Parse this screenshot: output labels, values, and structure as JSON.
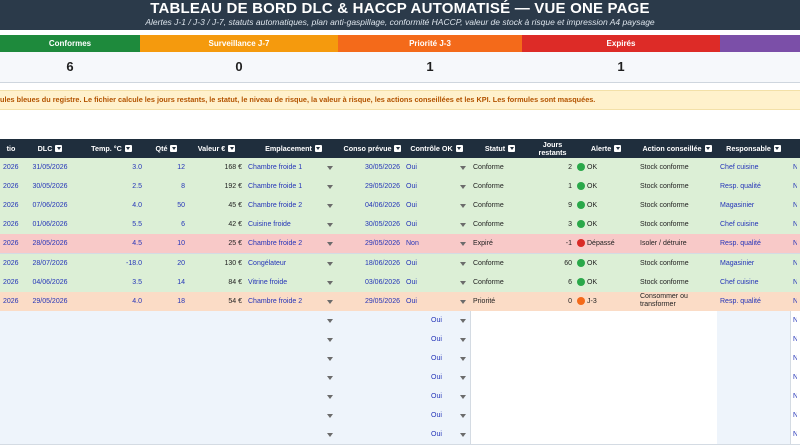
{
  "header": {
    "title": "TABLEAU DE BORD DLC & HACCP AUTOMATISÉ — VUE ONE PAGE",
    "subtitle": "Alertes J-1 / J-3 / J-7, statuts automatiques, plan anti-gaspillage, conformité HACCP, valeur de stock à risque et impression A4 paysage"
  },
  "kpis": [
    {
      "label": "Conformes",
      "value": "6",
      "color": "#1e8a3c"
    },
    {
      "label": "Surveillance J-7",
      "value": "0",
      "color": "#f59a0d"
    },
    {
      "label": "Priorité J-3",
      "value": "1",
      "color": "#f46a1a"
    },
    {
      "label": "Expirés",
      "value": "1",
      "color": "#dd2b27"
    },
    {
      "label": "",
      "value": "",
      "color": "#7b4fa8"
    }
  ],
  "note": "ules bleues du registre. Le fichier calcule les jours restants, le statut, le niveau de risque, la valeur à risque, les actions conseillées et les KPI. Les formules sont masquées.",
  "columns": [
    {
      "key": "rec",
      "label": "tio"
    },
    {
      "key": "dlc",
      "label": "DLC"
    },
    {
      "key": "temp",
      "label": "Temp. °C"
    },
    {
      "key": "qte",
      "label": "Qté"
    },
    {
      "key": "valeur",
      "label": "Valeur €"
    },
    {
      "key": "emplacement",
      "label": "Emplacement"
    },
    {
      "key": "conso",
      "label": "Conso prévue"
    },
    {
      "key": "controle",
      "label": "Contrôle OK"
    },
    {
      "key": "statut",
      "label": "Statut"
    },
    {
      "key": "jours",
      "label": "Jours restants"
    },
    {
      "key": "alerte",
      "label": "Alerte"
    },
    {
      "key": "action",
      "label": "Action conseillée"
    },
    {
      "key": "resp",
      "label": "Responsable"
    },
    {
      "key": "extra",
      "label": ""
    }
  ],
  "rows": [
    {
      "rec": "2026",
      "dlc": "31/05/2026",
      "temp": "3.0",
      "qte": "12",
      "valeur": "168 €",
      "emplacement": "Chambre froide 1",
      "conso": "30/05/2026",
      "controle": "Oui",
      "statut": "Conforme",
      "jours": "2",
      "alerte": "OK",
      "alert_color": "#2aa84a",
      "action": "Stock conforme",
      "resp": "Chef cuisine",
      "extra": "No",
      "bg": "#dcefd6"
    },
    {
      "rec": "2026",
      "dlc": "30/05/2026",
      "temp": "2.5",
      "qte": "8",
      "valeur": "192 €",
      "emplacement": "Chambre froide 1",
      "conso": "29/05/2026",
      "controle": "Oui",
      "statut": "Conforme",
      "jours": "1",
      "alerte": "OK",
      "alert_color": "#2aa84a",
      "action": "Stock conforme",
      "resp": "Resp. qualité",
      "extra": "No",
      "bg": "#dcefd6"
    },
    {
      "rec": "2026",
      "dlc": "07/06/2026",
      "temp": "4.0",
      "qte": "50",
      "valeur": "45 €",
      "emplacement": "Chambre froide 2",
      "conso": "04/06/2026",
      "controle": "Oui",
      "statut": "Conforme",
      "jours": "9",
      "alerte": "OK",
      "alert_color": "#2aa84a",
      "action": "Stock conforme",
      "resp": "Magasinier",
      "extra": "No",
      "bg": "#dcefd6"
    },
    {
      "rec": "2026",
      "dlc": "01/06/2026",
      "temp": "5.5",
      "qte": "6",
      "valeur": "42 €",
      "emplacement": "Cuisine froide",
      "conso": "30/05/2026",
      "controle": "Oui",
      "statut": "Conforme",
      "jours": "3",
      "alerte": "OK",
      "alert_color": "#2aa84a",
      "action": "Stock conforme",
      "resp": "Chef cuisine",
      "extra": "No",
      "bg": "#dcefd6"
    },
    {
      "rec": "2026",
      "dlc": "28/05/2026",
      "temp": "4.5",
      "qte": "10",
      "valeur": "25 €",
      "emplacement": "Chambre froide 2",
      "conso": "29/05/2026",
      "controle": "Non",
      "statut": "Expiré",
      "jours": "-1",
      "alerte": "Dépassé",
      "alert_color": "#d92a26",
      "action": "Isoler / détruire",
      "resp": "Resp. qualité",
      "extra": "No",
      "bg": "#f8c9c8"
    },
    {
      "rec": "2026",
      "dlc": "28/07/2026",
      "temp": "-18.0",
      "qte": "20",
      "valeur": "130 €",
      "emplacement": "Congélateur",
      "conso": "18/06/2026",
      "controle": "Oui",
      "statut": "Conforme",
      "jours": "60",
      "alerte": "OK",
      "alert_color": "#2aa84a",
      "action": "Stock conforme",
      "resp": "Magasinier",
      "extra": "No",
      "bg": "#dcefd6"
    },
    {
      "rec": "2026",
      "dlc": "04/06/2026",
      "temp": "3.5",
      "qte": "14",
      "valeur": "84 €",
      "emplacement": "Vitrine froide",
      "conso": "03/06/2026",
      "controle": "Oui",
      "statut": "Conforme",
      "jours": "6",
      "alerte": "OK",
      "alert_color": "#2aa84a",
      "action": "Stock conforme",
      "resp": "Chef cuisine",
      "extra": "No",
      "bg": "#dcefd6"
    },
    {
      "rec": "2026",
      "dlc": "29/05/2026",
      "temp": "4.0",
      "qte": "18",
      "valeur": "54 €",
      "emplacement": "Chambre froide 2",
      "conso": "29/05/2026",
      "controle": "Oui",
      "statut": "Priorité",
      "jours": "0",
      "alerte": "J-3",
      "alert_color": "#f46a1a",
      "action": "Consommer ou transformer",
      "resp": "Resp. qualité",
      "extra": "No",
      "bg": "#fbdcc6"
    }
  ],
  "empty_rows": [
    {
      "controle": "Oui",
      "extra": "No"
    },
    {
      "controle": "Oui",
      "extra": "No"
    },
    {
      "controle": "Oui",
      "extra": "No"
    },
    {
      "controle": "Oui",
      "extra": "No"
    },
    {
      "controle": "Oui",
      "extra": "No"
    },
    {
      "controle": "Oui",
      "extra": "No"
    },
    {
      "controle": "Oui",
      "extra": "No"
    }
  ]
}
